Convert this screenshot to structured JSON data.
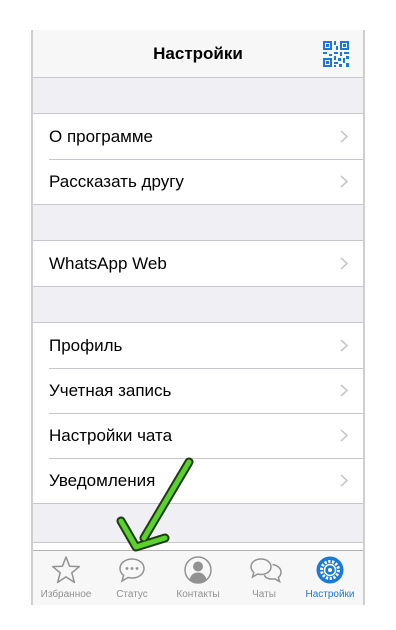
{
  "header": {
    "title": "Настройки"
  },
  "settings": {
    "group1": [
      "О программе",
      "Рассказать другу"
    ],
    "group2": [
      "WhatsApp Web"
    ],
    "group3": [
      "Профиль",
      "Учетная запись",
      "Настройки чата",
      "Уведомления"
    ]
  },
  "tabs": [
    {
      "label": "Избранное",
      "icon": "star-icon"
    },
    {
      "label": "Статус",
      "icon": "speech-bubble-icon"
    },
    {
      "label": "Контакты",
      "icon": "person-icon"
    },
    {
      "label": "Чаты",
      "icon": "chats-icon"
    },
    {
      "label": "Настройки",
      "icon": "gear-icon"
    }
  ],
  "colors": {
    "accent": "#1a7ad6",
    "arrow": "#5bd12c",
    "inactive": "#929292"
  }
}
